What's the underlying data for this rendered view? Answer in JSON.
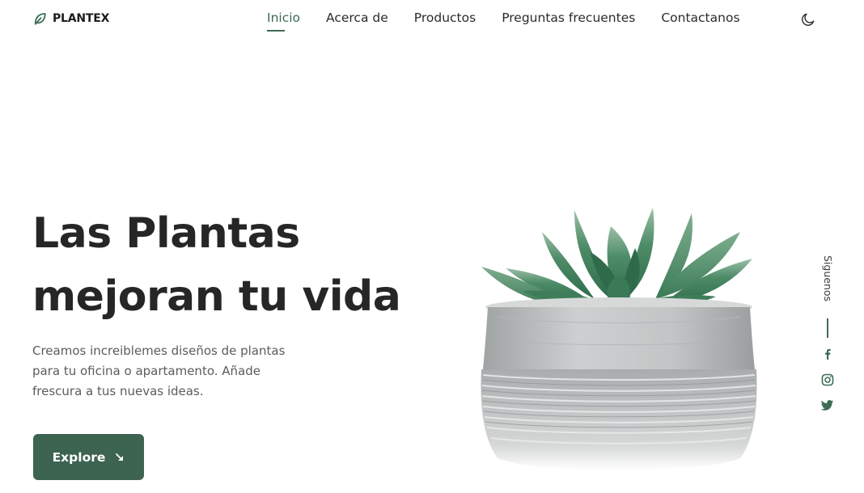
{
  "brand": {
    "name": "PLANTEX",
    "icon": "leaf-icon"
  },
  "nav": {
    "items": [
      {
        "label": "Inicio",
        "active": true
      },
      {
        "label": "Acerca de",
        "active": false
      },
      {
        "label": "Productos",
        "active": false
      },
      {
        "label": "Preguntas frecuentes",
        "active": false
      },
      {
        "label": "Contactanos",
        "active": false
      }
    ],
    "theme_icon": "moon-icon"
  },
  "hero": {
    "title_lines": [
      "Las Plantas",
      "mejoran tu vida"
    ],
    "description_lines": [
      "Creamos increiblemes diseños de plantas",
      "para tu oficina o apartamento. Añade",
      "frescura a tus nuevas ideas."
    ],
    "button_label": "Explore",
    "button_icon": "arrow-down-right-icon",
    "image": "succulent-in-concrete-pot"
  },
  "social": {
    "label": "Siguenos",
    "icons": [
      "facebook-icon",
      "instagram-icon",
      "twitter-icon"
    ]
  },
  "colors": {
    "accent": "#3d6b55",
    "button": "#3d6351",
    "text": "#262626",
    "muted": "#5c5c5c"
  }
}
